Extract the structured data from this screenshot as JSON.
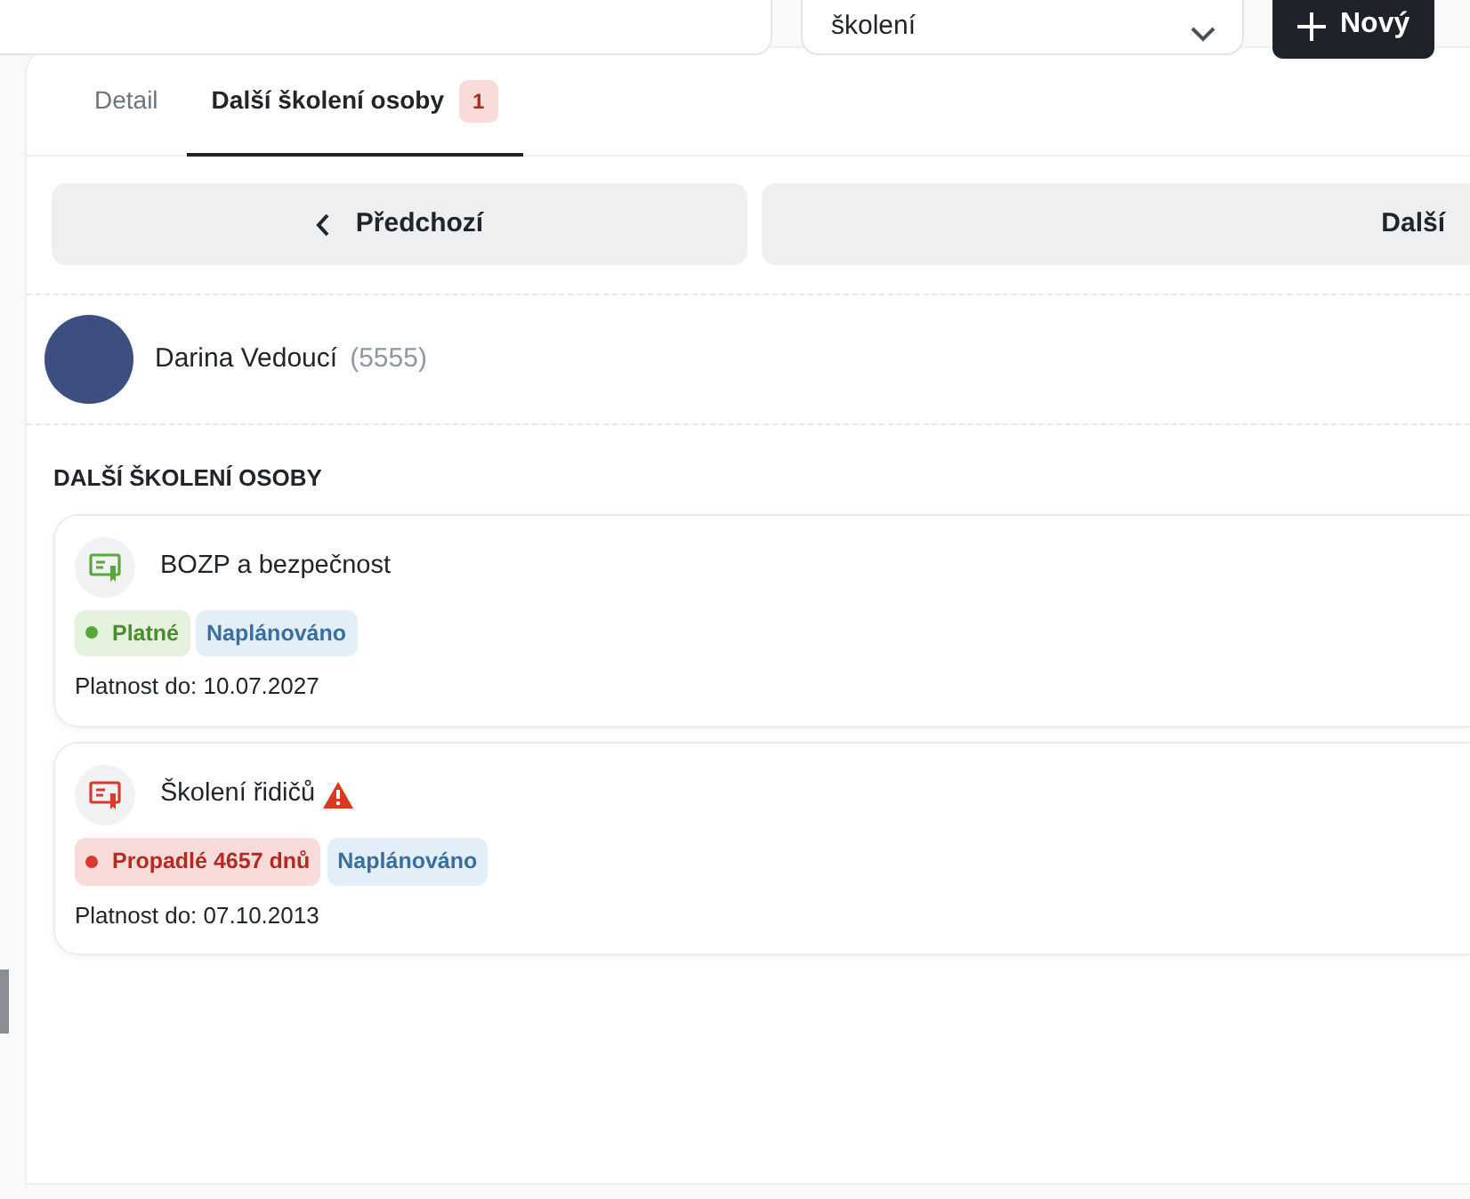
{
  "toolbar": {
    "filter": {
      "value": "školení"
    },
    "new_button": {
      "label": "Nový"
    }
  },
  "tabs": [
    {
      "label": "Detail",
      "selected": false
    },
    {
      "label": "Další školení osoby",
      "selected": true,
      "count": "1"
    }
  ],
  "pager": {
    "previous": "Předchozí",
    "next": "Další"
  },
  "person": {
    "name": "Darina Vedoucí",
    "number": "(5555)"
  },
  "section_title": "DALŠÍ ŠKOLENÍ OSOBY",
  "trainings": [
    {
      "title": "BOZP a bezpečnost",
      "kind": "valid",
      "warning": false,
      "badges": [
        {
          "kind": "status",
          "label": "Platné"
        },
        {
          "kind": "plan",
          "label": "Naplánováno"
        }
      ],
      "validity": "Platnost do: 10.07.2027"
    },
    {
      "title": "Školení řidičů",
      "kind": "expired",
      "warning": true,
      "badges": [
        {
          "kind": "status",
          "label": "Propadlé 4657 dnů"
        },
        {
          "kind": "plan",
          "label": "Naplánováno"
        }
      ],
      "validity": "Platnost do: 07.10.2013"
    }
  ]
}
